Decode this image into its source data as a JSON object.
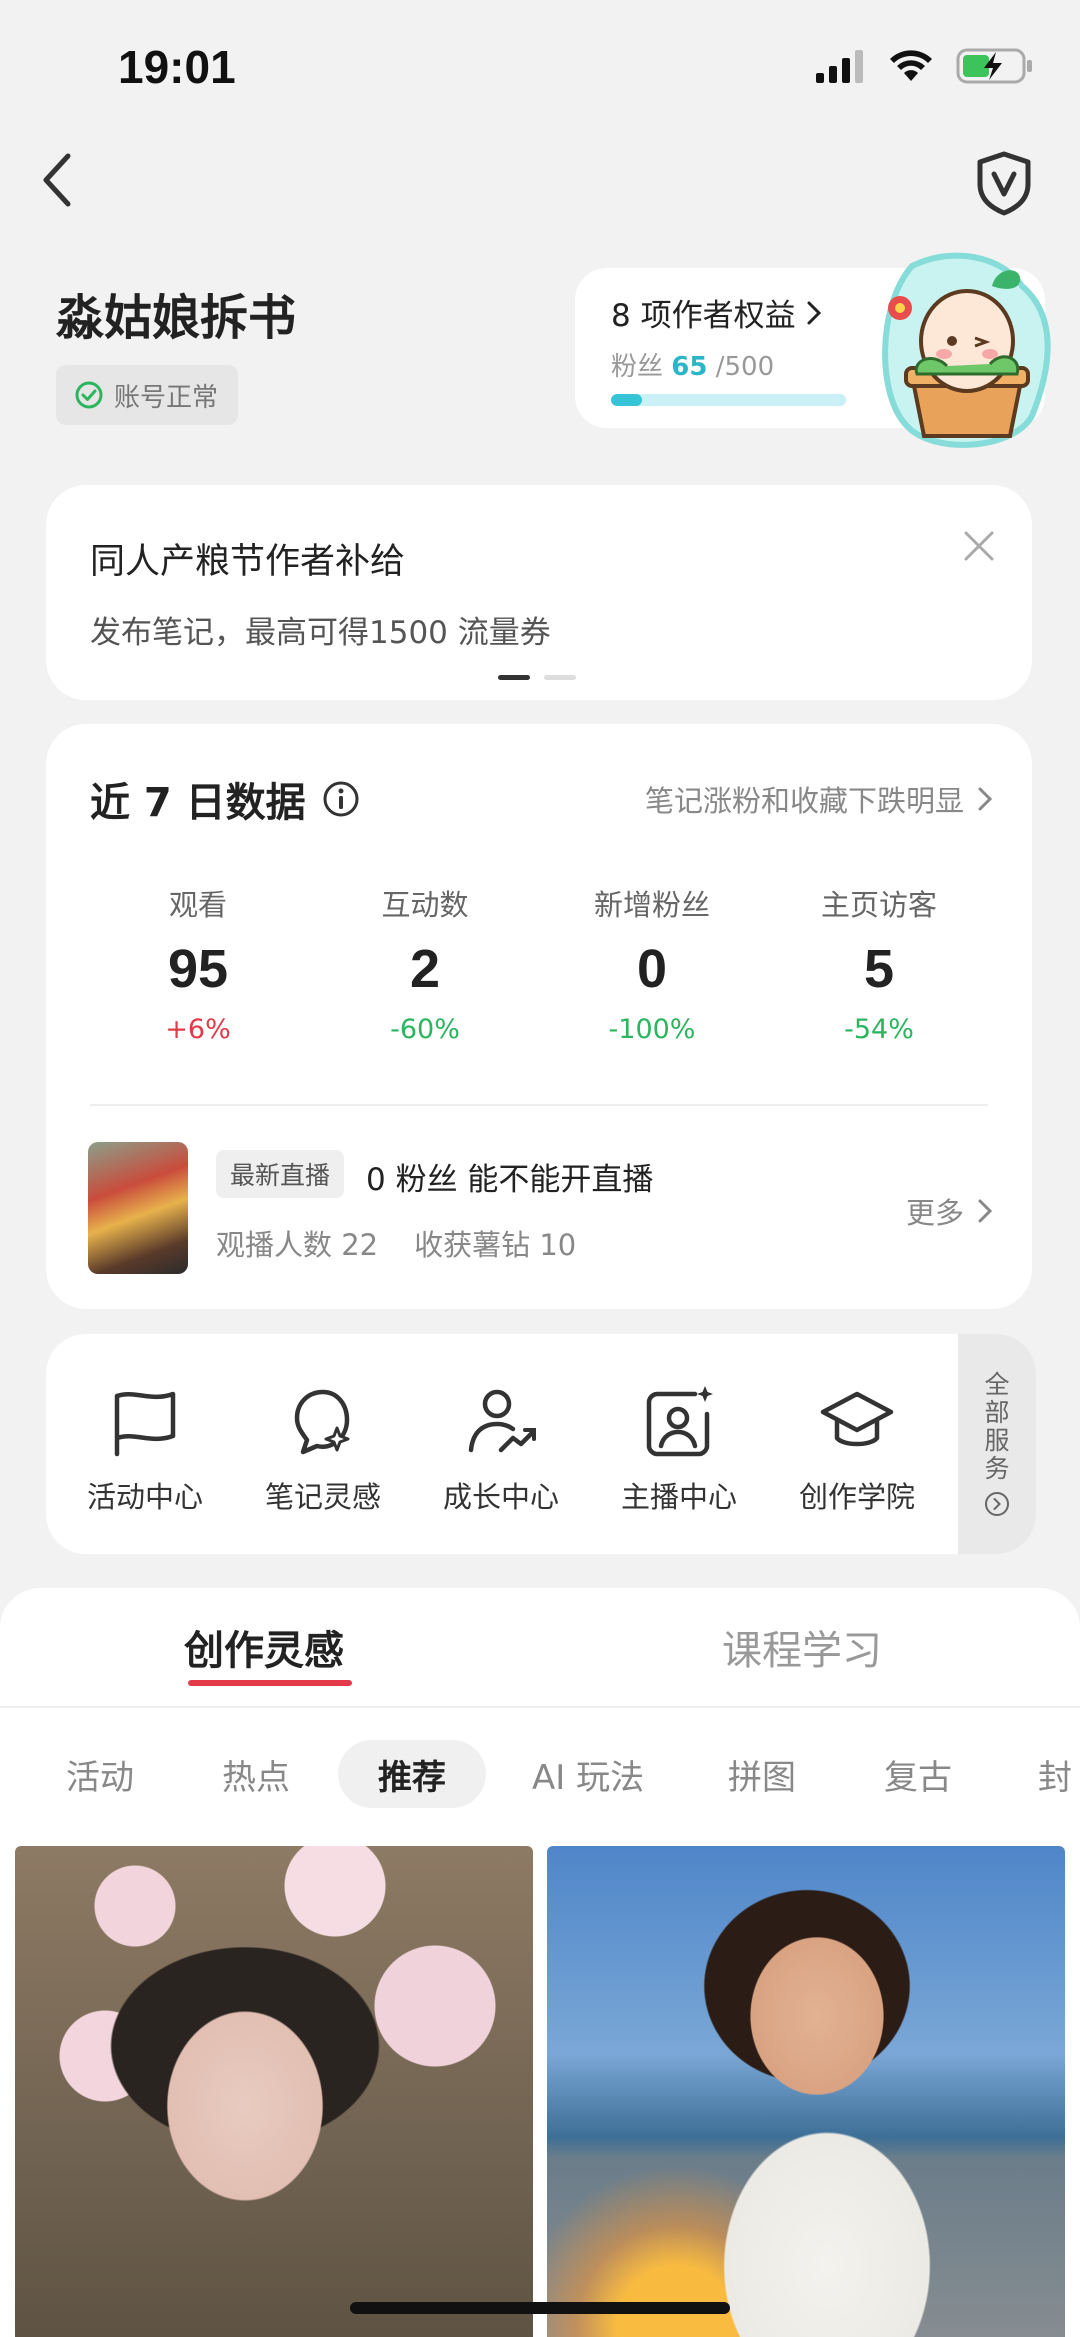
{
  "status_bar": {
    "time": "19:01"
  },
  "account": {
    "name": "淼姑娘拆书",
    "status": "账号正常"
  },
  "benefits": {
    "title": "8 项作者权益",
    "fans_label": "粉丝",
    "fans_count": "65",
    "fans_target": "/500",
    "progress": 0.13
  },
  "banner": {
    "title": "同人产粮节作者补给",
    "subtitle": "发布笔记，最高可得1500 流量券",
    "page_index": 0,
    "page_count": 2
  },
  "stats": {
    "title": "近 7 日数据",
    "hint": "笔记涨粉和收藏下跌明显",
    "items": [
      {
        "label": "观看",
        "value": "95",
        "change": "+6%"
      },
      {
        "label": "互动数",
        "value": "2",
        "change": "-60%"
      },
      {
        "label": "新增粉丝",
        "value": "0",
        "change": "-100%"
      },
      {
        "label": "主页访客",
        "value": "5",
        "change": "-54%"
      }
    ],
    "live": {
      "badge": "最新直播",
      "title": "0 粉丝 能不能开直播",
      "viewers": "观播人数 22",
      "earnings": "收获薯钻 10",
      "more": "更多"
    }
  },
  "services": {
    "items": [
      {
        "label": "活动中心",
        "icon": "flag-icon"
      },
      {
        "label": "笔记灵感",
        "icon": "lightbulb-icon"
      },
      {
        "label": "成长中心",
        "icon": "growth-user-icon"
      },
      {
        "label": "主播中心",
        "icon": "streamer-icon"
      },
      {
        "label": "创作学院",
        "icon": "graduation-cap-icon"
      }
    ],
    "all_label_chars": [
      "全",
      "部",
      "服",
      "务"
    ]
  },
  "tabs": {
    "primary": "创作灵感",
    "secondary": "课程学习"
  },
  "chips": [
    "活动",
    "热点",
    "推荐",
    "AI 玩法",
    "拼图",
    "复古",
    "封"
  ],
  "active_chip": "推荐",
  "colors": {
    "accent_red": "#e33a4a",
    "increase": "#e33a4a",
    "decrease": "#2bb55e",
    "fans_teal": "#36c4d8"
  }
}
